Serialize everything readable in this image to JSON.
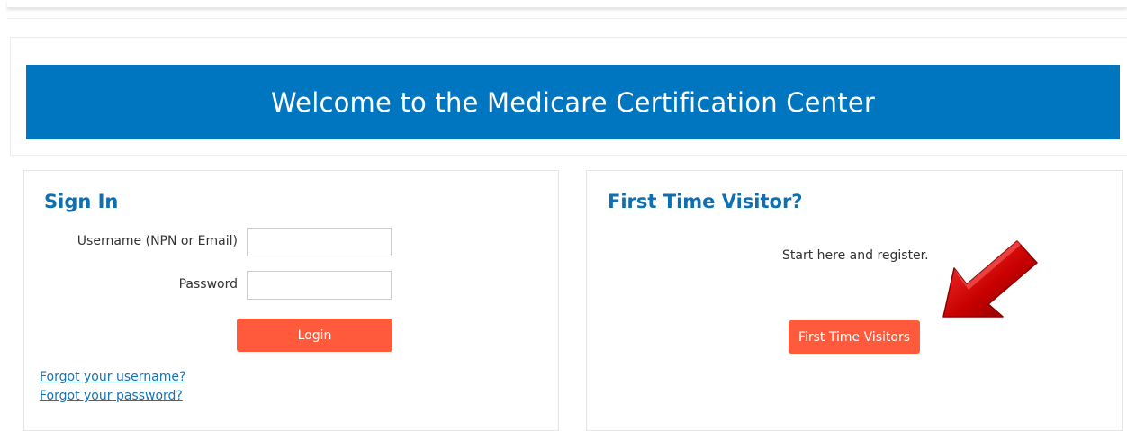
{
  "header": {
    "title": "Welcome to the Medicare Certification Center"
  },
  "sign_in": {
    "title": "Sign In",
    "username_label": "Username (NPN or Email)",
    "username_value": "",
    "password_label": "Password",
    "password_value": "",
    "login_label": "Login",
    "forgot_username": "Forgot your username?",
    "forgot_password": "Forgot your password?"
  },
  "first_time": {
    "title": "First Time Visitor?",
    "intro": "Start here and register.",
    "button_label": "First Time Visitors",
    "arrow_color": "#c80000"
  },
  "colors": {
    "brand_blue": "#0076c0",
    "title_blue": "#0e6fb2",
    "button_orange": "#ff5a3c",
    "link_blue": "#1a73b5"
  }
}
